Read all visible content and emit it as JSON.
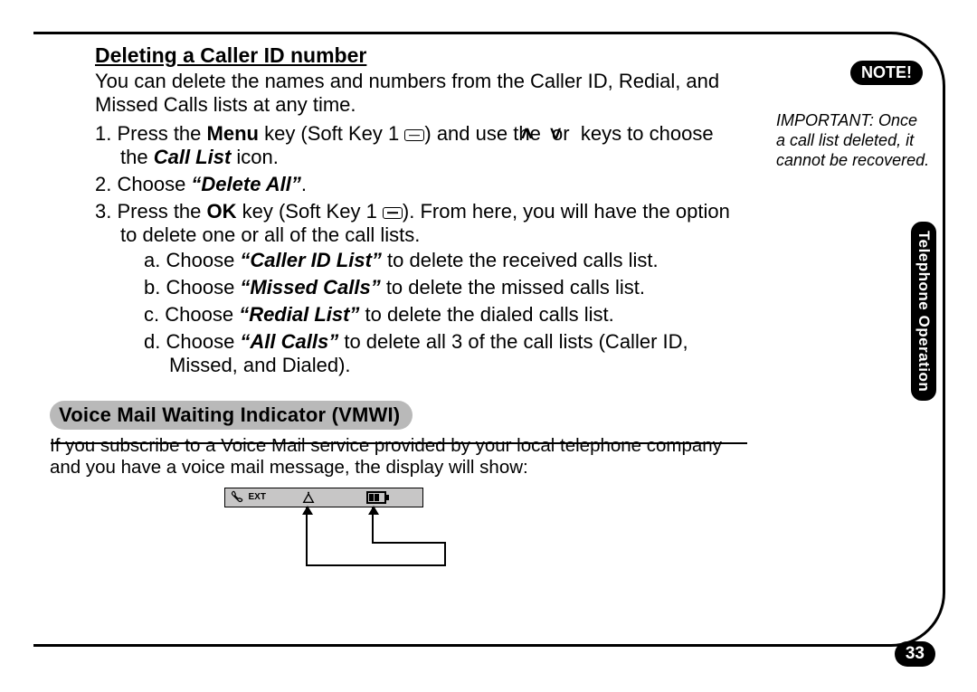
{
  "section1": {
    "title": "Deleting a Caller ID number",
    "intro": "You can delete the names and numbers from the Caller ID, Redial, and Missed Calls lists at any time.",
    "steps": {
      "s1a": "Press the ",
      "s1_menu": "Menu",
      "s1b": " key (Soft Key 1 ",
      "s1c": ") and use the ",
      "s1d": " or ",
      "s1e": " keys to choose the ",
      "s1_calllist": "Call List",
      "s1f": " icon.",
      "s2a": "Choose ",
      "s2_q": "“Delete All”",
      "s2b": ".",
      "s3a": "Press the ",
      "s3_ok": "OK",
      "s3b": " key (Soft Key 1 ",
      "s3c": "). From here, you will have the option to delete one or all of the call lists.",
      "sub": {
        "a_a": "Choose ",
        "a_q": "“Caller ID List”",
        "a_b": " to delete the received calls list.",
        "b_a": "Choose ",
        "b_q": "“Missed Calls”",
        "b_b": " to delete the missed calls list.",
        "c_a": "Choose ",
        "c_q": "“Redial List”",
        "c_b": " to delete the dialed calls list.",
        "d_a": "Choose ",
        "d_q": "“All Calls”",
        "d_b": " to delete all 3 of the call lists (Caller ID, Missed, and Dialed)."
      }
    }
  },
  "section2": {
    "pill": "Voice Mail Waiting Indicator (VMWI)",
    "text": "If you subscribe to a Voice Mail service provided by your local telephone company and you have a voice mail message, the display will show:",
    "lcd": {
      "ext": "EXT"
    }
  },
  "sidebar": {
    "note_pill": "NOTE!",
    "note_text": "IMPORTANT: Once a call list deleted, it cannot be recovered.",
    "tab": "Telephone Operation"
  },
  "page_number": "33"
}
